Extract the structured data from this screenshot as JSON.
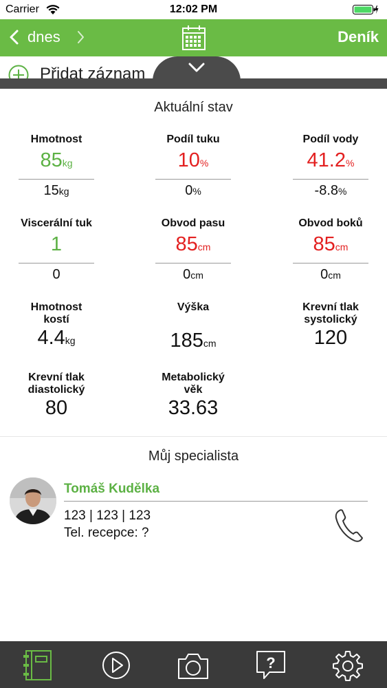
{
  "status_bar": {
    "carrier": "Carrier",
    "time": "12:02 PM"
  },
  "nav": {
    "day": "dnes",
    "diary_label": "Deník"
  },
  "add_record": {
    "label": "Přidat záznam"
  },
  "current_state": {
    "title": "Aktuální stav",
    "metrics": [
      {
        "label": "Hmotnost",
        "value": "85",
        "unit": "kg",
        "delta": "15",
        "delta_unit": "kg",
        "value_color": "#5cb144"
      },
      {
        "label": "Podíl tuku",
        "value": "10",
        "unit": "%",
        "delta": "0",
        "delta_unit": "%",
        "value_color": "#e32020"
      },
      {
        "label": "Podíl vody",
        "value": "41.2",
        "unit": "%",
        "delta": "-8.8",
        "delta_unit": "%",
        "value_color": "#e32020"
      },
      {
        "label": "Viscerální tuk",
        "value": "1",
        "unit": "",
        "delta": "0",
        "delta_unit": "",
        "value_color": "#5cb144"
      },
      {
        "label": "Obvod pasu",
        "value": "85",
        "unit": "cm",
        "delta": "0",
        "delta_unit": "cm",
        "value_color": "#e32020"
      },
      {
        "label": "Obvod boků",
        "value": "85",
        "unit": "cm",
        "delta": "0",
        "delta_unit": "cm",
        "value_color": "#e32020"
      },
      {
        "label": "Hmotnost kostí",
        "value": "4.4",
        "unit": "kg"
      },
      {
        "label": "Výška",
        "value": "185",
        "unit": "cm"
      },
      {
        "label": "Krevní tlak systolický",
        "value": "120",
        "unit": ""
      },
      {
        "label": "Krevní tlak diastolický",
        "value": "80",
        "unit": ""
      },
      {
        "label": "Metabolický věk",
        "value": "33.63",
        "unit": ""
      }
    ]
  },
  "specialist": {
    "title": "Můj specialista",
    "name": "Tomáš Kudělka",
    "phone": "123 | 123 | 123",
    "reception": "Tel. recepce: ?"
  },
  "tab_bar": {
    "items": [
      "diary-icon",
      "play-icon",
      "camera-icon",
      "help-icon",
      "gear-icon"
    ]
  },
  "colors": {
    "brand_green": "#6abb45",
    "value_green": "#5cb144",
    "value_red": "#e32020",
    "tab_bar": "#3a3a3a"
  }
}
